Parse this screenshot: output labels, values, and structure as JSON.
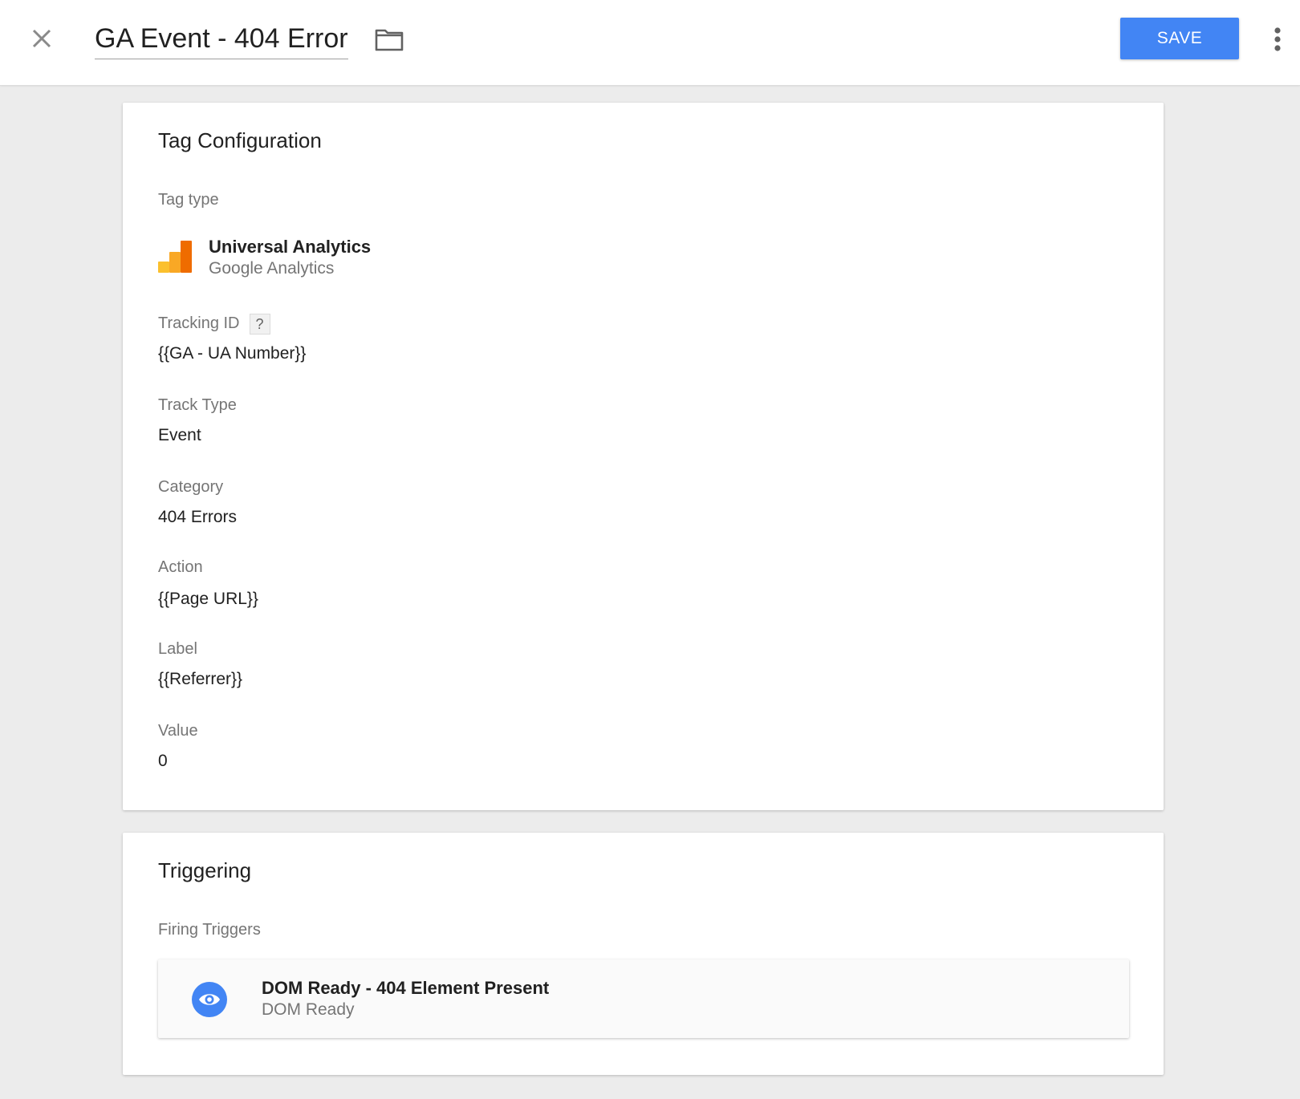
{
  "colors": {
    "accent": "#4285f4",
    "background": "#ececec",
    "card": "#ffffff",
    "label": "#757575",
    "text": "#212121"
  },
  "header": {
    "title": "GA Event - 404 Error",
    "save_label": "SAVE",
    "icons": [
      "close-icon",
      "folder-icon",
      "more-vert-icon"
    ]
  },
  "tag_configuration": {
    "title": "Tag Configuration",
    "tag_type_label": "Tag type",
    "tag_type": {
      "name": "Universal Analytics",
      "provider": "Google Analytics",
      "icon": "google-analytics-icon"
    },
    "tracking_id": {
      "label": "Tracking ID",
      "help": "?",
      "value": "{{GA - UA Number}}"
    },
    "track_type": {
      "label": "Track Type",
      "value": "Event"
    },
    "category": {
      "label": "Category",
      "value": "404 Errors"
    },
    "action": {
      "label": "Action",
      "value": "{{Page URL}}"
    },
    "label_field": {
      "label": "Label",
      "value": "{{Referrer}}"
    },
    "value_field": {
      "label": "Value",
      "value": "0"
    }
  },
  "triggering": {
    "title": "Triggering",
    "firing_label": "Firing Triggers",
    "triggers": [
      {
        "name": "DOM Ready - 404 Element Present",
        "type": "DOM Ready",
        "icon": "eye-icon"
      }
    ]
  }
}
